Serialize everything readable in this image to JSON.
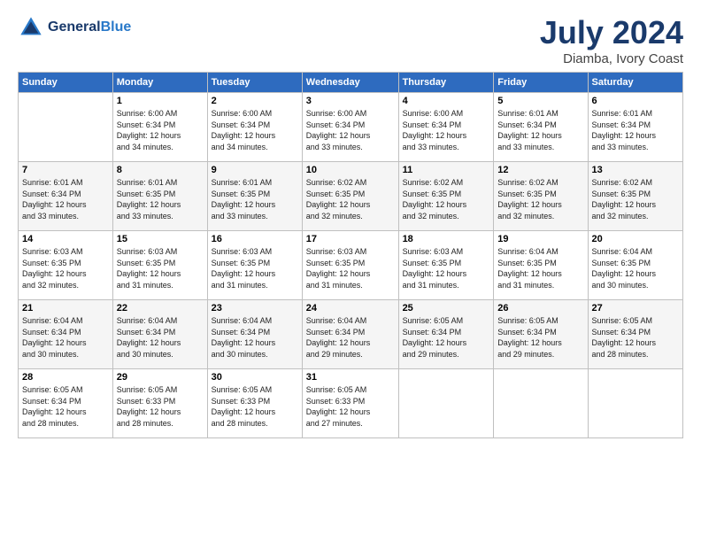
{
  "header": {
    "logo_line1": "General",
    "logo_line2": "Blue",
    "title": "July 2024",
    "subtitle": "Diamba, Ivory Coast"
  },
  "calendar": {
    "days_of_week": [
      "Sunday",
      "Monday",
      "Tuesday",
      "Wednesday",
      "Thursday",
      "Friday",
      "Saturday"
    ],
    "weeks": [
      [
        {
          "day": "",
          "info": ""
        },
        {
          "day": "1",
          "info": "Sunrise: 6:00 AM\nSunset: 6:34 PM\nDaylight: 12 hours\nand 34 minutes."
        },
        {
          "day": "2",
          "info": "Sunrise: 6:00 AM\nSunset: 6:34 PM\nDaylight: 12 hours\nand 34 minutes."
        },
        {
          "day": "3",
          "info": "Sunrise: 6:00 AM\nSunset: 6:34 PM\nDaylight: 12 hours\nand 33 minutes."
        },
        {
          "day": "4",
          "info": "Sunrise: 6:00 AM\nSunset: 6:34 PM\nDaylight: 12 hours\nand 33 minutes."
        },
        {
          "day": "5",
          "info": "Sunrise: 6:01 AM\nSunset: 6:34 PM\nDaylight: 12 hours\nand 33 minutes."
        },
        {
          "day": "6",
          "info": "Sunrise: 6:01 AM\nSunset: 6:34 PM\nDaylight: 12 hours\nand 33 minutes."
        }
      ],
      [
        {
          "day": "7",
          "info": "Sunrise: 6:01 AM\nSunset: 6:34 PM\nDaylight: 12 hours\nand 33 minutes."
        },
        {
          "day": "8",
          "info": "Sunrise: 6:01 AM\nSunset: 6:35 PM\nDaylight: 12 hours\nand 33 minutes."
        },
        {
          "day": "9",
          "info": "Sunrise: 6:01 AM\nSunset: 6:35 PM\nDaylight: 12 hours\nand 33 minutes."
        },
        {
          "day": "10",
          "info": "Sunrise: 6:02 AM\nSunset: 6:35 PM\nDaylight: 12 hours\nand 32 minutes."
        },
        {
          "day": "11",
          "info": "Sunrise: 6:02 AM\nSunset: 6:35 PM\nDaylight: 12 hours\nand 32 minutes."
        },
        {
          "day": "12",
          "info": "Sunrise: 6:02 AM\nSunset: 6:35 PM\nDaylight: 12 hours\nand 32 minutes."
        },
        {
          "day": "13",
          "info": "Sunrise: 6:02 AM\nSunset: 6:35 PM\nDaylight: 12 hours\nand 32 minutes."
        }
      ],
      [
        {
          "day": "14",
          "info": "Sunrise: 6:03 AM\nSunset: 6:35 PM\nDaylight: 12 hours\nand 32 minutes."
        },
        {
          "day": "15",
          "info": "Sunrise: 6:03 AM\nSunset: 6:35 PM\nDaylight: 12 hours\nand 31 minutes."
        },
        {
          "day": "16",
          "info": "Sunrise: 6:03 AM\nSunset: 6:35 PM\nDaylight: 12 hours\nand 31 minutes."
        },
        {
          "day": "17",
          "info": "Sunrise: 6:03 AM\nSunset: 6:35 PM\nDaylight: 12 hours\nand 31 minutes."
        },
        {
          "day": "18",
          "info": "Sunrise: 6:03 AM\nSunset: 6:35 PM\nDaylight: 12 hours\nand 31 minutes."
        },
        {
          "day": "19",
          "info": "Sunrise: 6:04 AM\nSunset: 6:35 PM\nDaylight: 12 hours\nand 31 minutes."
        },
        {
          "day": "20",
          "info": "Sunrise: 6:04 AM\nSunset: 6:35 PM\nDaylight: 12 hours\nand 30 minutes."
        }
      ],
      [
        {
          "day": "21",
          "info": "Sunrise: 6:04 AM\nSunset: 6:34 PM\nDaylight: 12 hours\nand 30 minutes."
        },
        {
          "day": "22",
          "info": "Sunrise: 6:04 AM\nSunset: 6:34 PM\nDaylight: 12 hours\nand 30 minutes."
        },
        {
          "day": "23",
          "info": "Sunrise: 6:04 AM\nSunset: 6:34 PM\nDaylight: 12 hours\nand 30 minutes."
        },
        {
          "day": "24",
          "info": "Sunrise: 6:04 AM\nSunset: 6:34 PM\nDaylight: 12 hours\nand 29 minutes."
        },
        {
          "day": "25",
          "info": "Sunrise: 6:05 AM\nSunset: 6:34 PM\nDaylight: 12 hours\nand 29 minutes."
        },
        {
          "day": "26",
          "info": "Sunrise: 6:05 AM\nSunset: 6:34 PM\nDaylight: 12 hours\nand 29 minutes."
        },
        {
          "day": "27",
          "info": "Sunrise: 6:05 AM\nSunset: 6:34 PM\nDaylight: 12 hours\nand 28 minutes."
        }
      ],
      [
        {
          "day": "28",
          "info": "Sunrise: 6:05 AM\nSunset: 6:34 PM\nDaylight: 12 hours\nand 28 minutes."
        },
        {
          "day": "29",
          "info": "Sunrise: 6:05 AM\nSunset: 6:33 PM\nDaylight: 12 hours\nand 28 minutes."
        },
        {
          "day": "30",
          "info": "Sunrise: 6:05 AM\nSunset: 6:33 PM\nDaylight: 12 hours\nand 28 minutes."
        },
        {
          "day": "31",
          "info": "Sunrise: 6:05 AM\nSunset: 6:33 PM\nDaylight: 12 hours\nand 27 minutes."
        },
        {
          "day": "",
          "info": ""
        },
        {
          "day": "",
          "info": ""
        },
        {
          "day": "",
          "info": ""
        }
      ]
    ]
  }
}
